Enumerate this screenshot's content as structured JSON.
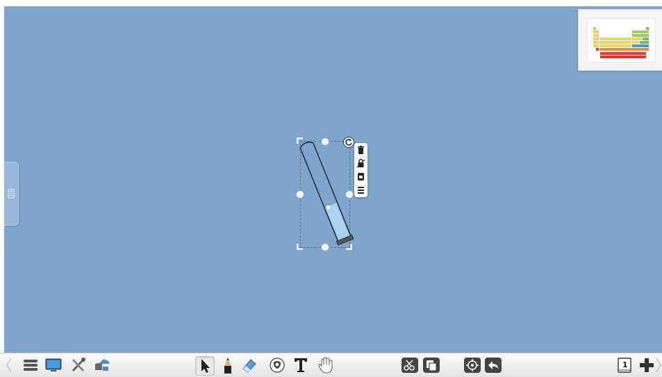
{
  "canvas": {
    "background": "#7fa5cd"
  },
  "colors": {
    "selection": "#5a6e86",
    "liquid": "#a9d3ef",
    "toolbar": "#ececec"
  },
  "object": {
    "name": "test-tube",
    "context_menu": [
      "trash-icon",
      "unlock-icon",
      "clone-icon",
      "menu-icon"
    ]
  },
  "thumbnail": {
    "name": "periodic-table-thumbnail"
  },
  "toolbar": {
    "left": [
      "menu-icon",
      "display-icon",
      "tools-icon",
      "cloud-icon"
    ],
    "center": [
      "select-icon",
      "pen-icon",
      "eraser-icon",
      "shape-icon",
      "text-icon",
      "hand-icon"
    ],
    "right": [
      "scissors-icon",
      "copy-icon",
      "target-icon",
      "undo-icon"
    ],
    "page_number": "1"
  }
}
